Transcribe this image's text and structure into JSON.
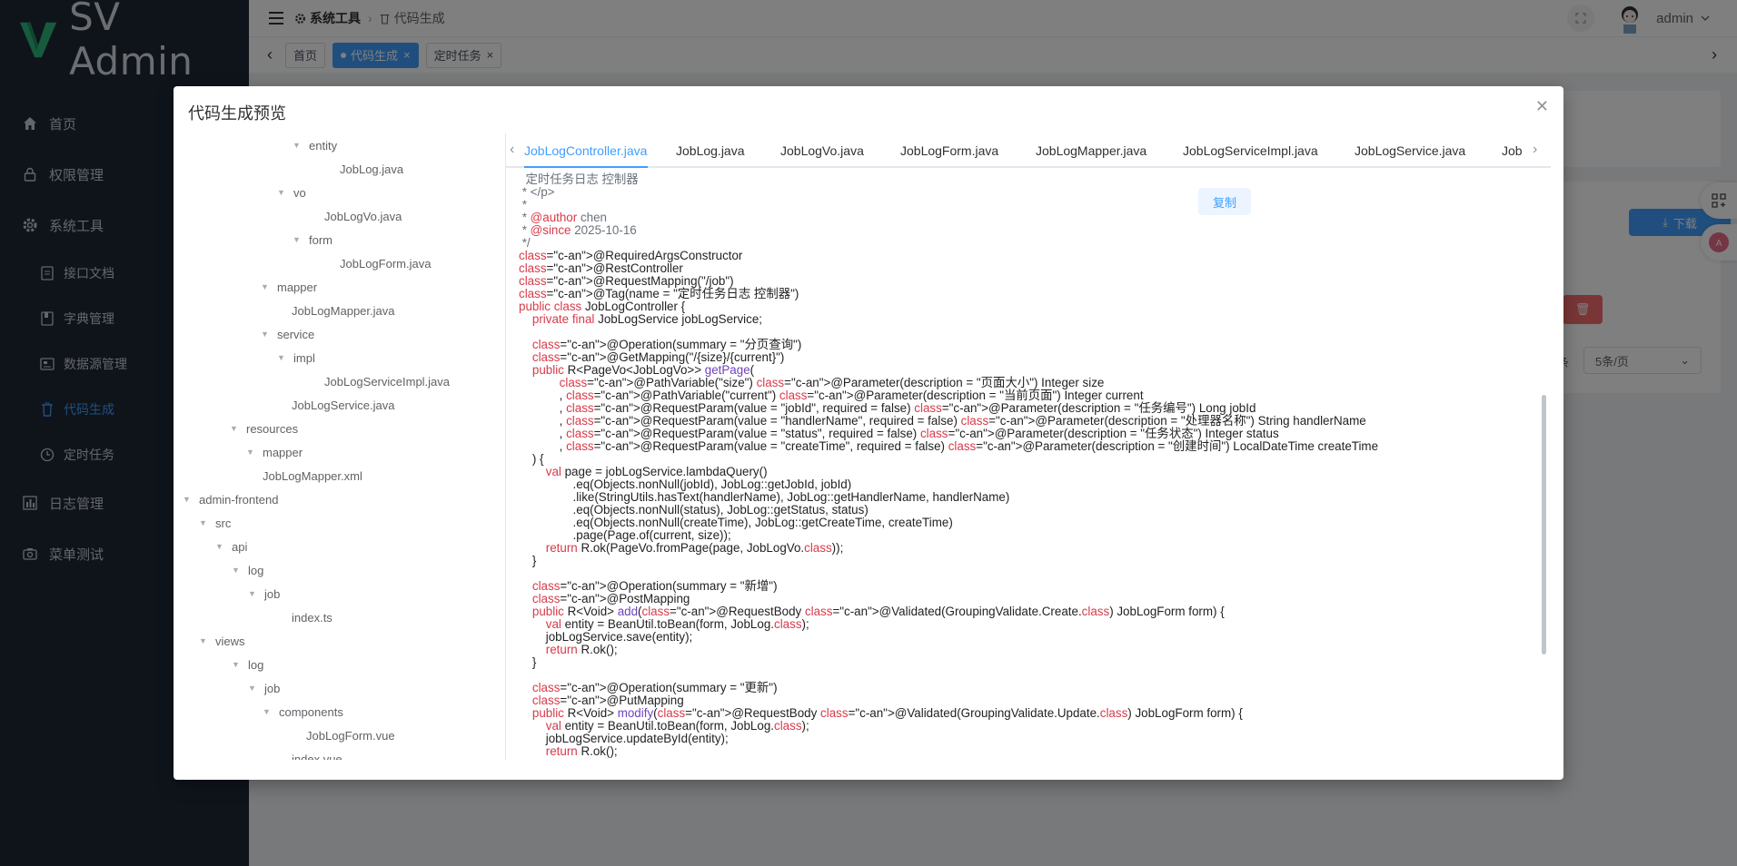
{
  "app": {
    "title": "SV Admin"
  },
  "sidebar": {
    "items": [
      {
        "label": "首页",
        "icon": "home-icon"
      },
      {
        "label": "权限管理",
        "icon": "lock-icon"
      },
      {
        "label": "系统工具",
        "icon": "gear-icon"
      },
      {
        "label": "接口文档",
        "icon": "document-icon"
      },
      {
        "label": "字典管理",
        "icon": "book-icon"
      },
      {
        "label": "数据源管理",
        "icon": "database-icon"
      },
      {
        "label": "代码生成",
        "icon": "trash-can-icon"
      },
      {
        "label": "定时任务",
        "icon": "clock-icon"
      },
      {
        "label": "日志管理",
        "icon": "chart-icon"
      },
      {
        "label": "菜单测试",
        "icon": "camera-icon"
      }
    ]
  },
  "header": {
    "breadcrumb": [
      "系统工具",
      "代码生成"
    ],
    "username": "admin"
  },
  "tags": [
    {
      "label": "首页"
    },
    {
      "label": "代码生成"
    },
    {
      "label": "定时任务"
    }
  ],
  "background": {
    "download_label": "下载",
    "page_size": "5条/页",
    "page_size_suffix": "条"
  },
  "dialog": {
    "title": "代码生成预览",
    "copy_label": "复制",
    "tabs": [
      "JobLogController.java",
      "JobLog.java",
      "JobLogVo.java",
      "JobLogForm.java",
      "JobLogMapper.java",
      "JobLogServiceImpl.java",
      "JobLogService.java",
      "Job"
    ],
    "tree": [
      {
        "label": "entity",
        "folder": true
      },
      {
        "label": "JobLog.java",
        "folder": false
      },
      {
        "label": "vo",
        "folder": true
      },
      {
        "label": "JobLogVo.java",
        "folder": false
      },
      {
        "label": "form",
        "folder": true
      },
      {
        "label": "JobLogForm.java",
        "folder": false
      },
      {
        "label": "mapper",
        "folder": true
      },
      {
        "label": "JobLogMapper.java",
        "folder": false
      },
      {
        "label": "service",
        "folder": true
      },
      {
        "label": "impl",
        "folder": true
      },
      {
        "label": "JobLogServiceImpl.java",
        "folder": false
      },
      {
        "label": "JobLogService.java",
        "folder": false
      },
      {
        "label": "resources",
        "folder": true
      },
      {
        "label": "mapper",
        "folder": true
      },
      {
        "label": "JobLogMapper.xml",
        "folder": false
      },
      {
        "label": "admin-frontend",
        "folder": true
      },
      {
        "label": "src",
        "folder": true
      },
      {
        "label": "api",
        "folder": true
      },
      {
        "label": "log",
        "folder": true
      },
      {
        "label": "job",
        "folder": true
      },
      {
        "label": "index.ts",
        "folder": false
      },
      {
        "label": "views",
        "folder": true
      },
      {
        "label": "log",
        "folder": true
      },
      {
        "label": "job",
        "folder": true
      },
      {
        "label": "components",
        "folder": true
      },
      {
        "label": "JobLogForm.vue",
        "folder": false
      },
      {
        "label": "index.vue",
        "folder": false
      }
    ],
    "code": [
      "  定时任务日志 控制器",
      " * </p>",
      " *",
      " * @author chen",
      " * @since 2025-10-16",
      " */",
      "@RequiredArgsConstructor",
      "@RestController",
      "@RequestMapping(\"/job\")",
      "@Tag(name = \"定时任务日志 控制器\")",
      "public class JobLogController {",
      "    private final JobLogService jobLogService;",
      "",
      "    @Operation(summary = \"分页查询\")",
      "    @GetMapping(\"/{size}/{current}\")",
      "    public R<PageVo<JobLogVo>> getPage(",
      "            @PathVariable(\"size\") @Parameter(description = \"页面大小\") Integer size",
      "            , @PathVariable(\"current\") @Parameter(description = \"当前页面\") Integer current",
      "            , @RequestParam(value = \"jobId\", required = false) @Parameter(description = \"任务编号\") Long jobId",
      "            , @RequestParam(value = \"handlerName\", required = false) @Parameter(description = \"处理器名称\") String handlerName",
      "            , @RequestParam(value = \"status\", required = false) @Parameter(description = \"任务状态\") Integer status",
      "            , @RequestParam(value = \"createTime\", required = false) @Parameter(description = \"创建时间\") LocalDateTime createTime",
      "    ) {",
      "        val page = jobLogService.lambdaQuery()",
      "                .eq(Objects.nonNull(jobId), JobLog::getJobId, jobId)",
      "                .like(StringUtils.hasText(handlerName), JobLog::getHandlerName, handlerName)",
      "                .eq(Objects.nonNull(status), JobLog::getStatus, status)",
      "                .eq(Objects.nonNull(createTime), JobLog::getCreateTime, createTime)",
      "                .page(Page.of(current, size));",
      "        return R.ok(PageVo.fromPage(page, JobLogVo.class));",
      "    }",
      "",
      "    @Operation(summary = \"新增\")",
      "    @PostMapping",
      "    public R<Void> add(@RequestBody @Validated(GroupingValidate.Create.class) JobLogForm form) {",
      "        val entity = BeanUtil.toBean(form, JobLog.class);",
      "        jobLogService.save(entity);",
      "        return R.ok();",
      "    }",
      "",
      "    @Operation(summary = \"更新\")",
      "    @PutMapping",
      "    public R<Void> modify(@RequestBody @Validated(GroupingValidate.Update.class) JobLogForm form) {",
      "        val entity = BeanUtil.toBean(form, JobLog.class);",
      "        jobLogService.updateById(entity);",
      "        return R.ok();"
    ]
  }
}
